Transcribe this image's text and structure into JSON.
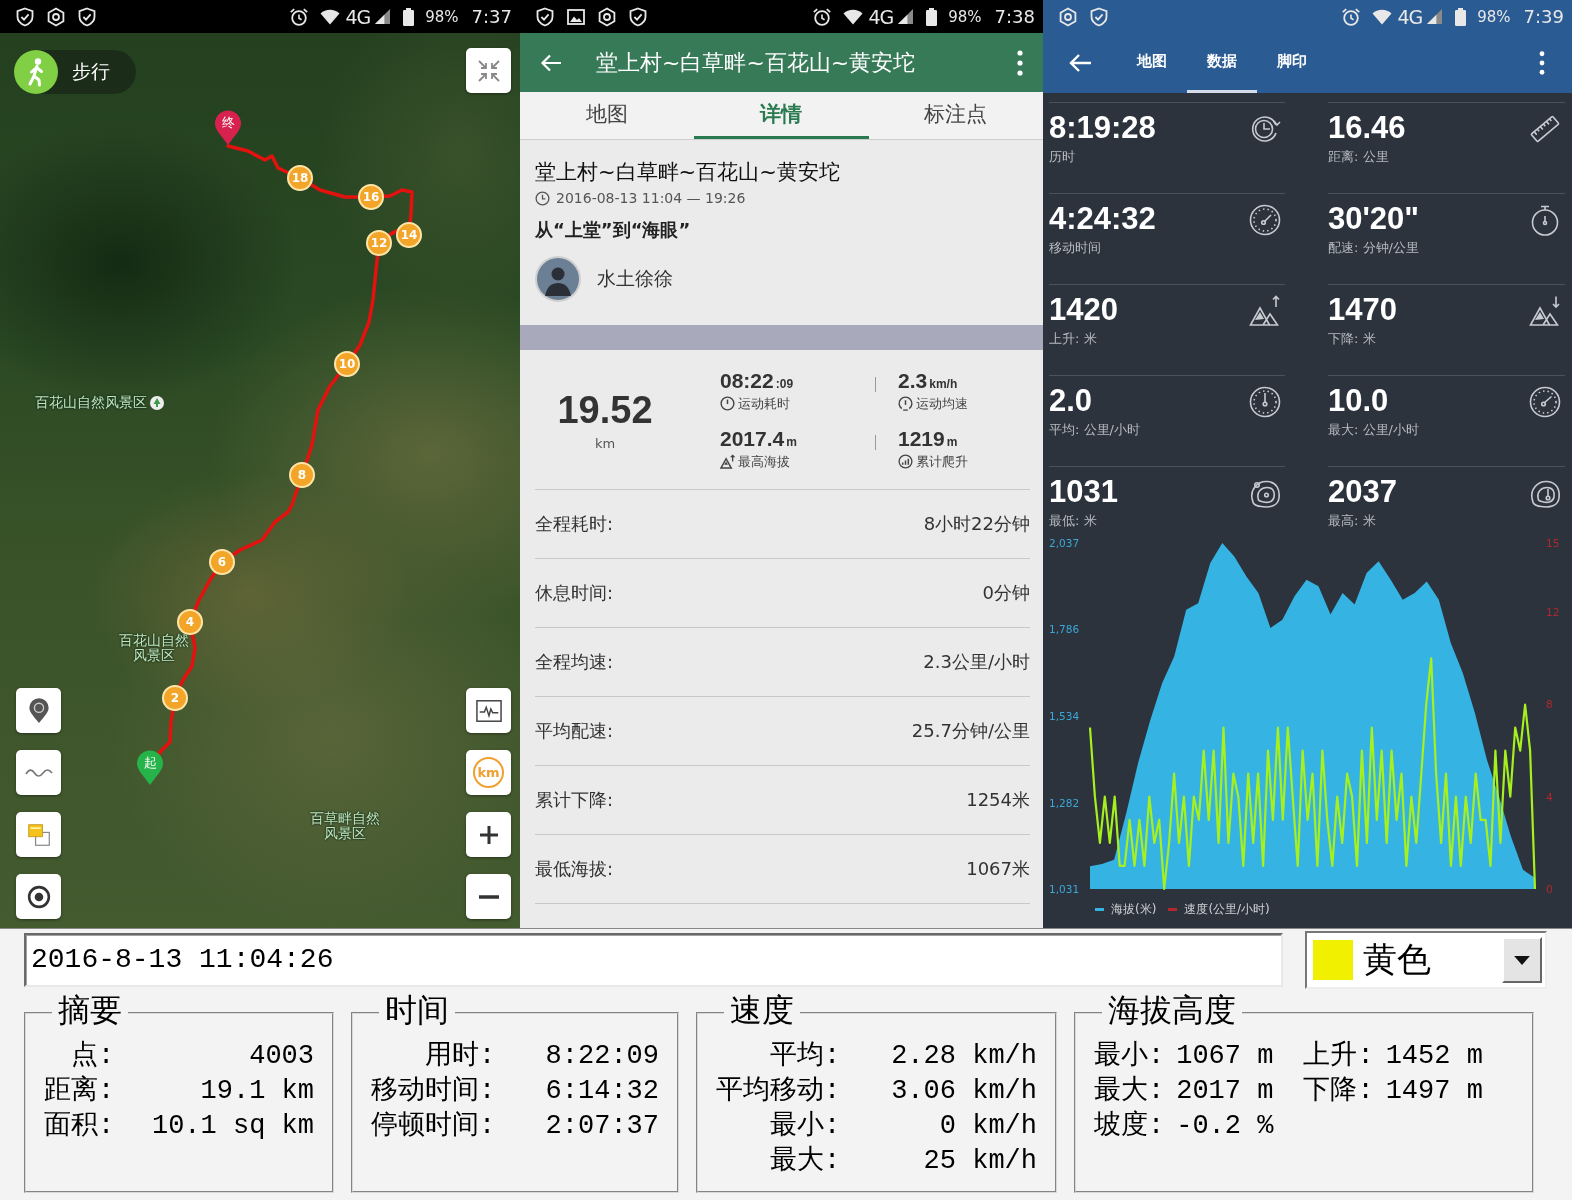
{
  "map_screen": {
    "status_bar": {
      "network": "4G",
      "battery": "98%",
      "time": "7:37"
    },
    "mode_button": "步行",
    "map_labels": [
      "百花山自然风景区",
      "百花山自然风景区",
      "百草畔自然风景区"
    ],
    "markers": [
      {
        "kind": "end",
        "label": "终"
      },
      {
        "kind": "km",
        "label": "18"
      },
      {
        "kind": "km",
        "label": "16"
      },
      {
        "kind": "km",
        "label": "14"
      },
      {
        "kind": "km",
        "label": "12"
      },
      {
        "kind": "km",
        "label": "10"
      },
      {
        "kind": "km",
        "label": "8"
      },
      {
        "kind": "km",
        "label": "6"
      },
      {
        "kind": "km",
        "label": "4"
      },
      {
        "kind": "km",
        "label": "2"
      },
      {
        "kind": "start",
        "label": "起"
      }
    ],
    "unit_button": "km"
  },
  "detail_screen": {
    "status_bar": {
      "network": "4G",
      "battery": "98%",
      "time": "7:38"
    },
    "title": "堂上村~白草畔~百花山~黄安坨",
    "tabs": [
      {
        "label": "地图",
        "selected": false
      },
      {
        "label": "详情",
        "selected": true
      },
      {
        "label": "标注点",
        "selected": false
      }
    ],
    "track_title": "堂上村~白草畔~百花山~黄安坨",
    "time_range": "2016-08-13 11:04 — 19:26",
    "description": "从“上堂”到“海眼”",
    "author": "水土徐徐",
    "distance": {
      "value": "19.52",
      "unit": "km"
    },
    "stats": [
      {
        "value": "08:22",
        "unit": ":09",
        "label": "运动耗时"
      },
      {
        "value": "2.3",
        "unit": "km/h",
        "label": "运动均速"
      },
      {
        "value": "2017.4",
        "unit": "m",
        "label": "最高海拔"
      },
      {
        "value": "1219",
        "unit": "m",
        "label": "累计爬升"
      }
    ],
    "rows": [
      {
        "label": "全程耗时:",
        "value": "8小时22分钟"
      },
      {
        "label": "休息时间:",
        "value": "0分钟"
      },
      {
        "label": "全程均速:",
        "value": "2.3公里/小时"
      },
      {
        "label": "平均配速:",
        "value": "25.7分钟/公里"
      },
      {
        "label": "累计下降:",
        "value": "1254米"
      },
      {
        "label": "最低海拔:",
        "value": "1067米"
      }
    ]
  },
  "data_screen": {
    "status_bar": {
      "network": "4G",
      "battery": "98%",
      "time": "7:39"
    },
    "tabs": [
      {
        "label": "地图",
        "selected": false
      },
      {
        "label": "数据",
        "selected": true
      },
      {
        "label": "脚印",
        "selected": false
      }
    ],
    "metrics": [
      {
        "value": "8:19:28",
        "label": "历时"
      },
      {
        "value": "16.46",
        "label": "距离: 公里"
      },
      {
        "value": "4:24:32",
        "label": "移动时间"
      },
      {
        "value": "30'20\"",
        "label": "配速: 分钟/公里"
      },
      {
        "value": "1420",
        "label": "上升: 米"
      },
      {
        "value": "1470",
        "label": "下降: 米"
      },
      {
        "value": "2.0",
        "label": "平均: 公里/小时"
      },
      {
        "value": "10.0",
        "label": "最大: 公里/小时"
      },
      {
        "value": "1031",
        "label": "最低: 米"
      },
      {
        "value": "2037",
        "label": "最高: 米"
      }
    ],
    "elevation_chart": {
      "chart_data": {
        "type": "area",
        "series": [
          {
            "name": "海拔(米)",
            "color": "#35b4e4",
            "values": [
              1097,
              1104,
              1116,
              1250,
              1397,
              1520,
              1630,
              1707,
              1843,
              1862,
              1979,
              2037,
              1998,
              1940,
              1892,
              1790,
              1814,
              1882,
              1930,
              1911,
              1829,
              1892,
              1858,
              1950,
              1984,
              1930,
              1872,
              1892,
              1925,
              1872,
              1746,
              1659,
              1543,
              1407,
              1300,
              1184,
              1087,
              1063
            ]
          }
        ],
        "ylim": [
          1031,
          2037
        ],
        "yticks": [
          {
            "value": 2037,
            "label": "2,037"
          },
          {
            "value": 1786,
            "label": "1,786"
          },
          {
            "value": 1534,
            "label": "1,534"
          },
          {
            "value": 1282,
            "label": "1,282"
          },
          {
            "value": 1031,
            "label": "1,031"
          }
        ]
      }
    },
    "speed_chart": {
      "chart_data": {
        "type": "line",
        "series": [
          {
            "name": "速度(公里/小时)",
            "color": "#a6f01e",
            "values": [
              7,
              4,
              2,
              4,
              2,
              4,
              1,
              1,
              3,
              1,
              3,
              1,
              4,
              2,
              3,
              0,
              2,
              5,
              2,
              4,
              1,
              4,
              3,
              6,
              3,
              6,
              2,
              7,
              2,
              5,
              4,
              1,
              5,
              2,
              5,
              1,
              6,
              3,
              7,
              3,
              7,
              4,
              1,
              6,
              3,
              5,
              1,
              6,
              3,
              1,
              4,
              2,
              5,
              4,
              1,
              6,
              2,
              7,
              3,
              6,
              2,
              6,
              3,
              5,
              1,
              4,
              2,
              5,
              8,
              10,
              5,
              2,
              5,
              1,
              4,
              1,
              4,
              2,
              5,
              3,
              3,
              1,
              6,
              2,
              6,
              4,
              7,
              6,
              8,
              6,
              0
            ]
          }
        ],
        "ylim": [
          0,
          15
        ],
        "yticks": [
          15,
          12,
          8,
          4,
          0
        ]
      },
      "legend_marker": {
        "color": "#b3282d"
      }
    }
  },
  "bottom_panel": {
    "timestamp": "2016-8-13 11:04:26",
    "color_select": {
      "label": "黄色",
      "color": "#f0f000"
    },
    "groups": [
      {
        "title": "摘要",
        "rows": [
          [
            {
              "label": "点:",
              "value": "4003"
            }
          ],
          [
            {
              "label": "距离:",
              "value": "19.1 km"
            }
          ],
          [
            {
              "label": "面积:",
              "value": "10.1 sq km"
            }
          ]
        ]
      },
      {
        "title": "时间",
        "rows": [
          [
            {
              "label": "用时:",
              "value": "8:22:09"
            }
          ],
          [
            {
              "label": "移动时间:",
              "value": "6:14:32"
            }
          ],
          [
            {
              "label": "停顿时间:",
              "value": "2:07:37"
            }
          ]
        ]
      },
      {
        "title": "速度",
        "rows": [
          [
            {
              "label": "平均:",
              "value": "2.28 km/h"
            }
          ],
          [
            {
              "label": "平均移动:",
              "value": "3.06 km/h"
            }
          ],
          [
            {
              "label": "最小:",
              "value": "0 km/h"
            }
          ],
          [
            {
              "label": "最大:",
              "value": "25 km/h"
            }
          ]
        ]
      },
      {
        "title": "海拔高度",
        "rows": [
          [
            {
              "label": "最小:",
              "value": "1067 m"
            },
            {
              "label": "上升:",
              "value": "1452 m"
            }
          ],
          [
            {
              "label": "最大:",
              "value": "2017 m"
            },
            {
              "label": "下降:",
              "value": "1497 m"
            }
          ],
          [
            {
              "label": "坡度:",
              "value": "-0.2 %"
            }
          ]
        ]
      }
    ]
  }
}
